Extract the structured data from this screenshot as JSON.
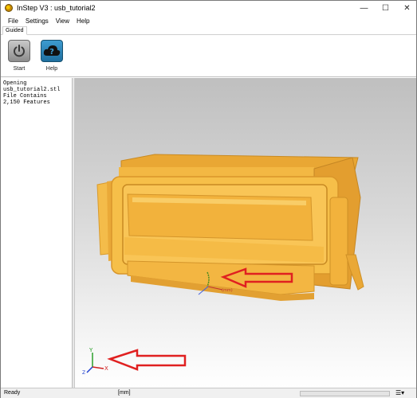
{
  "window": {
    "title": "InStep V3 : usb_tutorial2",
    "controls": {
      "minimize": "—",
      "maximize": "☐",
      "close": "✕"
    }
  },
  "menu": [
    "File",
    "Settings",
    "View",
    "Help"
  ],
  "ribbon": {
    "tab": "Guided",
    "buttons": [
      {
        "label": "Start",
        "icon": "power-icon"
      },
      {
        "label": "Help",
        "icon": "cloud-question-icon"
      }
    ]
  },
  "log": {
    "lines": [
      "Opening",
      "usb_tutorial2.stl",
      "File Contains",
      "2,150 Features"
    ]
  },
  "viewport": {
    "model_color": "#f2b23c",
    "annotation_color": "#e02020",
    "axis_labels": {
      "x": "X",
      "y": "Y",
      "z": "Z"
    },
    "small_axis_label": "(mm)"
  },
  "status": {
    "text": "Ready",
    "units": "[mm]",
    "menu_glyph": "☰▾"
  }
}
